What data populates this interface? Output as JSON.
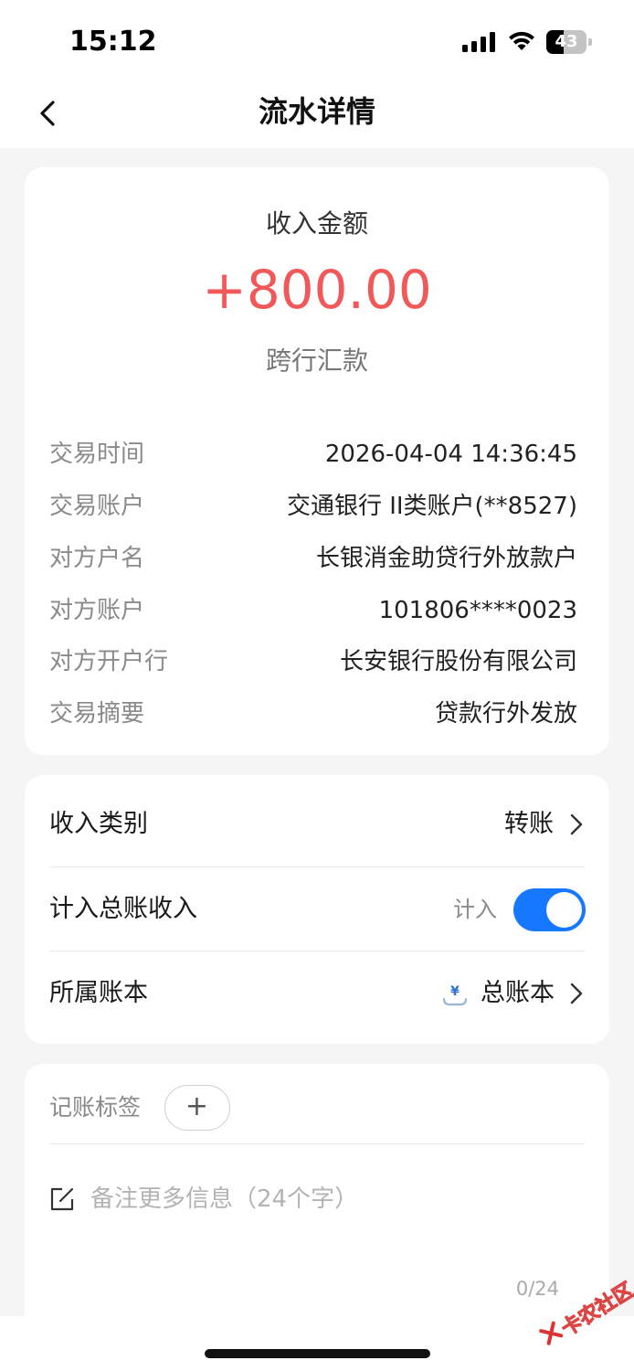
{
  "status_bar": {
    "time": "15:12",
    "battery": "43",
    "battery_level": 0.43
  },
  "nav": {
    "title": "流水详情",
    "back_icon": "chevron-left-icon"
  },
  "summary": {
    "amount_label": "收入金额",
    "amount": "+800.00",
    "amount_color": "#f0585a",
    "type": "跨行汇款",
    "details": [
      {
        "label": "交易时间",
        "value": "2026-04-04 14:36:45"
      },
      {
        "label": "交易账户",
        "value": "交通银行 II类账户(**8527)"
      },
      {
        "label": "对方户名",
        "value": "长银消金助贷行外放款户"
      },
      {
        "label": "对方账户",
        "value": "101806****0023"
      },
      {
        "label": "对方开户行",
        "value": "长安银行股份有限公司"
      },
      {
        "label": "交易摘要",
        "value": "贷款行外发放"
      }
    ]
  },
  "settings": {
    "category_label": "收入类别",
    "category_value": "转账",
    "ledger_income_label": "计入总账收入",
    "ledger_income_caption": "计入",
    "ledger_income_on": true,
    "ledger_label": "所属账本",
    "ledger_value": "总账本",
    "accent_color": "#1677ff"
  },
  "notes": {
    "tags_label": "记账标签",
    "add_tag_symbol": "+",
    "placeholder": "备注更多信息（24个字）",
    "value": "",
    "char_count": "0/24"
  },
  "watermark": {
    "text": "卡农社区"
  }
}
